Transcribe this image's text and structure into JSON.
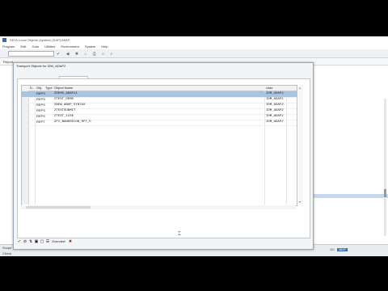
{
  "window": {
    "title": "SE03 Local Objects (system) [SAP] ABAP"
  },
  "menu": [
    "Program",
    "Edit",
    "Goto",
    "Utilities",
    "Environment",
    "System",
    "Help"
  ],
  "app": {
    "title": "Report"
  },
  "dialog": {
    "title": "Transport Objects for IDM_ADAP2",
    "tabs": [
      {
        "label": "Transportable Objects"
      },
      {
        "label": "Local objects"
      }
    ],
    "active_tab": 1,
    "columns": {
      "d": "D..",
      "obj": "Obj.",
      "type": "Type",
      "name": "Object Name",
      "user": "User"
    },
    "rows": [
      {
        "type": "REPS",
        "name": "ZDEMO_ABAP11",
        "user": "IDM_ADAP2",
        "selected": true
      },
      {
        "type": "REPS",
        "name": "ZTEST_DEMO",
        "user": "IDM_ADAP2",
        "selected": false
      },
      {
        "type": "REPS",
        "name": "ZNEW_ABAP_SYNTAX",
        "user": "IDM_ADAP2",
        "selected": false
      },
      {
        "type": "REPS",
        "name": "ZTESTSUBMIT",
        "user": "IDM_ADAP2",
        "selected": false
      },
      {
        "type": "REPS",
        "name": "ZTEST_1235",
        "user": "IDM_ADAP2",
        "selected": false
      },
      {
        "type": "REPT",
        "name": "ZFI_BANKRECON_RPT_5",
        "user": "IDM_ADAP2",
        "selected": false
      }
    ],
    "footer": {
      "overview_label": "Overview"
    }
  },
  "status": {
    "system": "ABAP",
    "client": "110",
    "line1": "Scope",
    "line2": "Check"
  }
}
